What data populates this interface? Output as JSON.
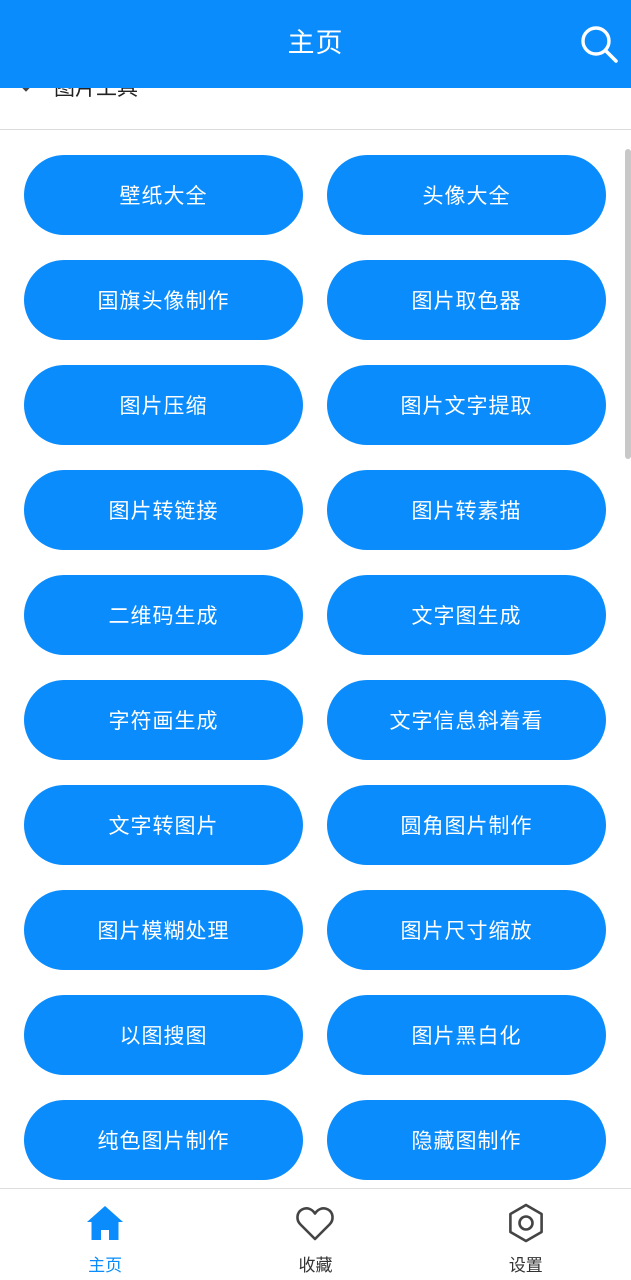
{
  "header": {
    "title": "主页",
    "search_icon": "search-icon"
  },
  "category": {
    "label": "图片工具",
    "icon": "chevron-icon"
  },
  "tools": [
    "壁纸大全",
    "头像大全",
    "国旗头像制作",
    "图片取色器",
    "图片压缩",
    "图片文字提取",
    "图片转链接",
    "图片转素描",
    "二维码生成",
    "文字图生成",
    "字符画生成",
    "文字信息斜着看",
    "文字转图片",
    "圆角图片制作",
    "图片模糊处理",
    "图片尺寸缩放",
    "以图搜图",
    "图片黑白化",
    "纯色图片制作",
    "隐藏图制作"
  ],
  "nav": {
    "items": [
      {
        "label": "主页",
        "icon": "home-icon",
        "active": true
      },
      {
        "label": "收藏",
        "icon": "heart-icon",
        "active": false
      },
      {
        "label": "设置",
        "icon": "settings-icon",
        "active": false
      }
    ]
  },
  "colors": {
    "accent": "#0a8cfc",
    "button_text": "#ffffff",
    "nav_inactive": "#333333"
  }
}
